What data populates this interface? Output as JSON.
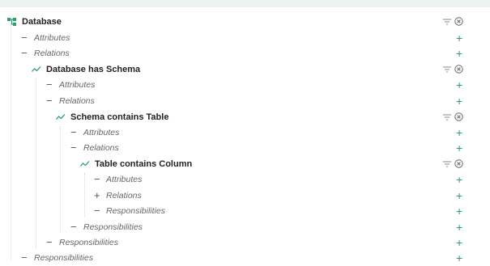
{
  "colors": {
    "accent": "#2e9f6a",
    "guide": "#d4d8d8",
    "muted_text": "#666666"
  },
  "icons": {
    "root": "entity-icon",
    "relation": "relation-icon",
    "filter": "filter-icon",
    "remove": "remove-icon",
    "add": "add-icon"
  },
  "tree": {
    "root": {
      "title": "Database",
      "attributes": {
        "toggle": "−",
        "label": "Attributes",
        "add": "+"
      },
      "relations": {
        "toggle": "−",
        "label": "Relations",
        "add": "+"
      },
      "responsibilities": {
        "toggle": "−",
        "label": "Responsibilities",
        "add": "+"
      }
    },
    "schema": {
      "title": "Database has Schema",
      "attributes": {
        "toggle": "−",
        "label": "Attributes",
        "add": "+"
      },
      "relations": {
        "toggle": "−",
        "label": "Relations",
        "add": "+"
      },
      "responsibilities": {
        "toggle": "−",
        "label": "Responsibilities",
        "add": "+"
      }
    },
    "table": {
      "title": "Schema contains Table",
      "attributes": {
        "toggle": "−",
        "label": "Attributes",
        "add": "+"
      },
      "relations": {
        "toggle": "−",
        "label": "Relations",
        "add": "+"
      },
      "responsibilities": {
        "toggle": "−",
        "label": "Responsibilities",
        "add": "+"
      }
    },
    "column": {
      "title": "Table contains Column",
      "attributes": {
        "toggle": "−",
        "label": "Attributes",
        "add": "+"
      },
      "relations": {
        "toggle": "+",
        "label": "Relations",
        "add": "+"
      },
      "responsibilities": {
        "toggle": "−",
        "label": "Responsibilities",
        "add": "+"
      }
    }
  }
}
